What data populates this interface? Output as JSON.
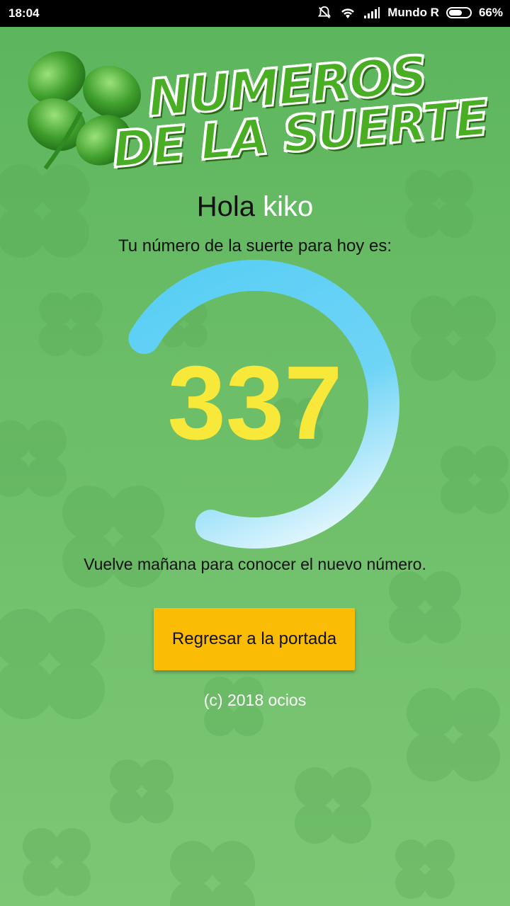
{
  "status_bar": {
    "time": "18:04",
    "carrier": "Mundo R",
    "battery": "66%",
    "battery_level": 0.66,
    "icons": [
      "mute-notification-icon",
      "wifi-icon",
      "signal-icon",
      "battery-icon"
    ]
  },
  "logo": {
    "line1": "NUMEROS",
    "line2": "DE LA SUERTE",
    "icon": "four-leaf-clover-icon"
  },
  "greeting": {
    "hello": "Hola",
    "username": "kiko"
  },
  "subtitle": "Tu número de la suerte para hoy es:",
  "lucky_number": "337",
  "ring_progress": 0.72,
  "footnote": "Vuelve mañana para  conocer el nuevo número.",
  "back_button_label": "Regresar a la portada",
  "copyright": "(c) 2018 ocios",
  "colors": {
    "background": "#6bbd67",
    "ring": "#56cdf5",
    "number": "#f8e83a",
    "button": "#fbbc05"
  }
}
